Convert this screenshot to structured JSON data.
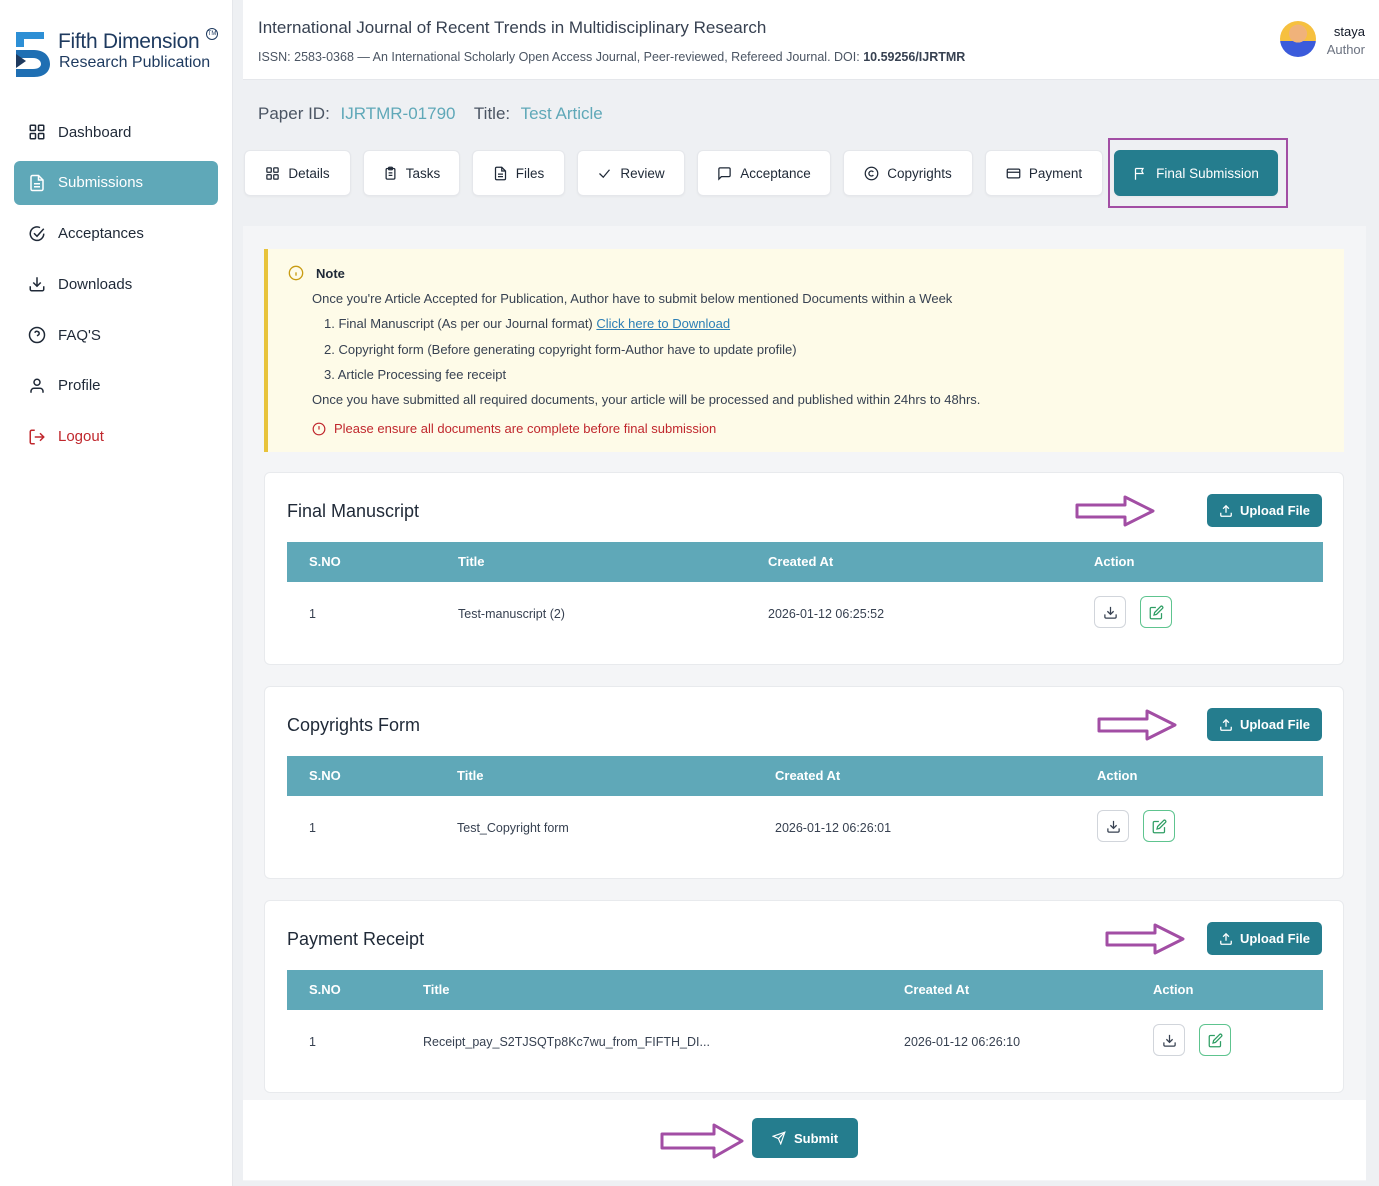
{
  "brand": {
    "name_line1": "Fifth Dimension",
    "name_line2": "Research Publication",
    "tm": "TM"
  },
  "sidebar": {
    "items": [
      {
        "label": "Dashboard",
        "icon": "grid-icon"
      },
      {
        "label": "Submissions",
        "icon": "document-icon",
        "active": true
      },
      {
        "label": "Acceptances",
        "icon": "check-circle-icon"
      },
      {
        "label": "Downloads",
        "icon": "download-icon"
      },
      {
        "label": "FAQ'S",
        "icon": "question-circle-icon"
      },
      {
        "label": "Profile",
        "icon": "user-icon"
      },
      {
        "label": "Logout",
        "icon": "logout-icon"
      }
    ]
  },
  "header": {
    "journal_title": "International Journal of Recent Trends in Multidisciplinary Research",
    "journal_sub": "ISSN: 2583-0368 — An International Scholarly Open Access Journal, Peer-reviewed, Refereed Journal. DOI: ",
    "doi": "10.59256/IJRTMR",
    "user_name": "staya",
    "user_role": "Author"
  },
  "paper": {
    "id_label": "Paper ID:",
    "id_value": "IJRTMR-01790",
    "title_label": "Title:",
    "title_value": "Test Article"
  },
  "tabs": [
    {
      "label": "Details",
      "icon": "grid-icon"
    },
    {
      "label": "Tasks",
      "icon": "clipboard-icon"
    },
    {
      "label": "Files",
      "icon": "file-icon"
    },
    {
      "label": "Review",
      "icon": "check-icon"
    },
    {
      "label": "Acceptance",
      "icon": "message-icon"
    },
    {
      "label": "Copyrights",
      "icon": "copyright-icon"
    },
    {
      "label": "Payment",
      "icon": "card-icon"
    },
    {
      "label": "Final Submission",
      "icon": "flag-icon",
      "active": true
    }
  ],
  "note": {
    "heading": "Note",
    "intro": "Once you're Article Accepted for Publication, Author have to submit below mentioned Documents within a Week",
    "item1": "1. Final Manuscript (As per our Journal format) ",
    "item1_link": "Click here to Download",
    "item2": "2. Copyright form (Before generating copyright form-Author have to update profile)",
    "item3": "3. Article Processing fee receipt",
    "outro": "Once you have submitted all required documents, your article will be processed and published within 24hrs to 48hrs.",
    "warning": "Please ensure all documents are complete before final submission"
  },
  "sections": {
    "manuscript": {
      "title": "Final Manuscript",
      "upload_label": "Upload File",
      "headers": [
        "S.NO",
        "Title",
        "Created At",
        "Action"
      ],
      "row": {
        "sno": "1",
        "title": "Test-manuscript (2)",
        "created": "2026-01-12 06:25:52"
      }
    },
    "copyright": {
      "title": "Copyrights Form",
      "upload_label": "Upload File",
      "headers": [
        "S.NO",
        "Title",
        "Created At",
        "Action"
      ],
      "row": {
        "sno": "1",
        "title": "Test_Copyright form",
        "created": "2026-01-12 06:26:01"
      }
    },
    "payment": {
      "title": "Payment Receipt",
      "upload_label": "Upload File",
      "headers": [
        "S.NO",
        "Title",
        "Created At",
        "Action"
      ],
      "row": {
        "sno": "1",
        "title": "Receipt_pay_S2TJSQTp8Kc7wu_from_FIFTH_DI...",
        "created": "2026-01-12 06:26:10"
      }
    }
  },
  "submit": {
    "label": "Submit"
  },
  "colors": {
    "primary": "#257d8e",
    "table_header": "#5fa8b8",
    "annotation_arrow": "#a24ea4",
    "warning": "#c0272d",
    "note_bg": "#fefbe8"
  }
}
